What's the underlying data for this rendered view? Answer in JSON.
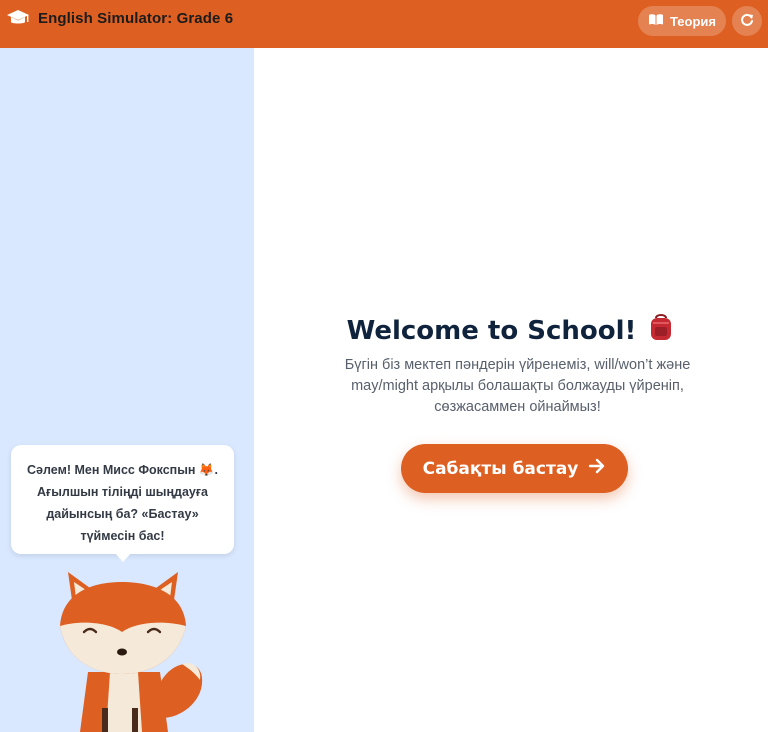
{
  "header": {
    "title": "English Simulator: Grade 6",
    "theory_label": "Теория",
    "icons": {
      "brand": "graduation-cap-icon",
      "theory": "book-icon",
      "reset": "refresh-icon"
    }
  },
  "sidebar": {
    "speech": "Сәлем! Мен Мисс Фокспын 🦊. Ағылшын тіліңді шыңдауға дайынсың ба? «Бастау» түймесін бас!",
    "mascot": "fox-mascot"
  },
  "main": {
    "title": "Welcome to School!",
    "title_icon": "backpack-icon",
    "description": "Бүгін біз мектеп пәндерін үйренеміз, will/won’t және may/might арқылы болашақты болжауды үйреніп, сөзжасаммен ойнаймыз!",
    "start_label": "Сабақты бастау",
    "start_icon": "arrow-right-icon"
  },
  "colors": {
    "accent": "#dd5f22",
    "sidebar_bg": "#d9e8ff",
    "title": "#10233d",
    "text": "#58606c"
  }
}
